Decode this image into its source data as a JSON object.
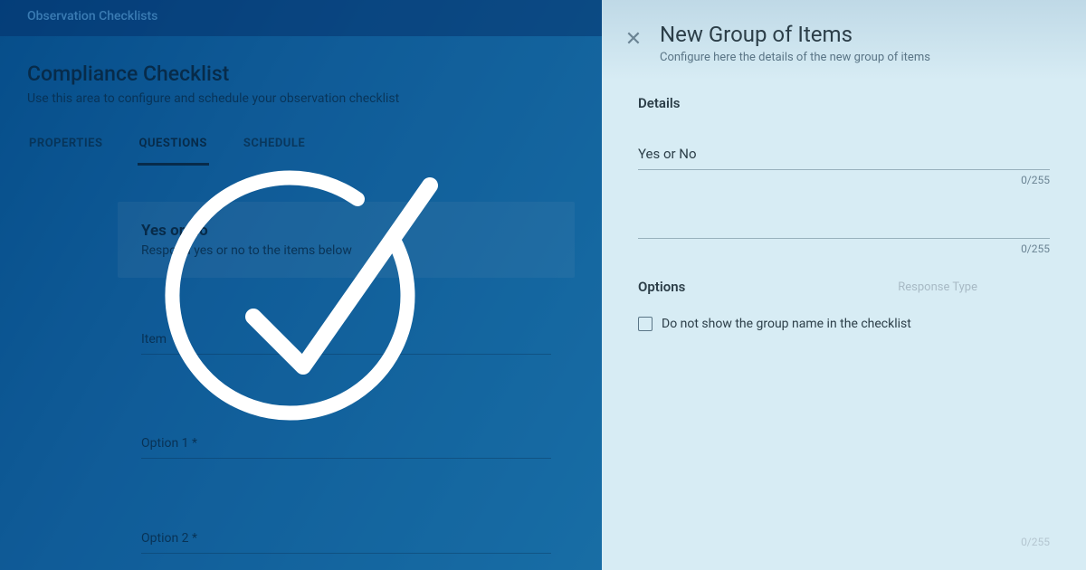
{
  "breadcrumb": "Observation Checklists",
  "header": {
    "title": "Compliance Checklist",
    "subtitle": "Use this area to configure and schedule your observation checklist"
  },
  "tabs": [
    {
      "label": "PROPERTIES",
      "active": false
    },
    {
      "label": "QUESTIONS",
      "active": true
    },
    {
      "label": "SCHEDULE",
      "active": false
    }
  ],
  "group_card": {
    "title": "Yes or No",
    "description": "Respond yes or no to the items below"
  },
  "fields": {
    "item_label": "Item",
    "option1_label": "Option 1 *",
    "option2_label": "Option 2 *"
  },
  "panel": {
    "title": "New Group of Items",
    "subtitle": "Configure here the details of the new group of items",
    "close_glyph": "✕",
    "details_label": "Details",
    "name_value": "Yes or No",
    "counter1": "0/255",
    "counter2": "0/255",
    "options_label": "Options",
    "response_type_label": "Response Type",
    "checkbox_label": "Do not show the group name in the checklist",
    "ghost_counter": "0/255"
  }
}
